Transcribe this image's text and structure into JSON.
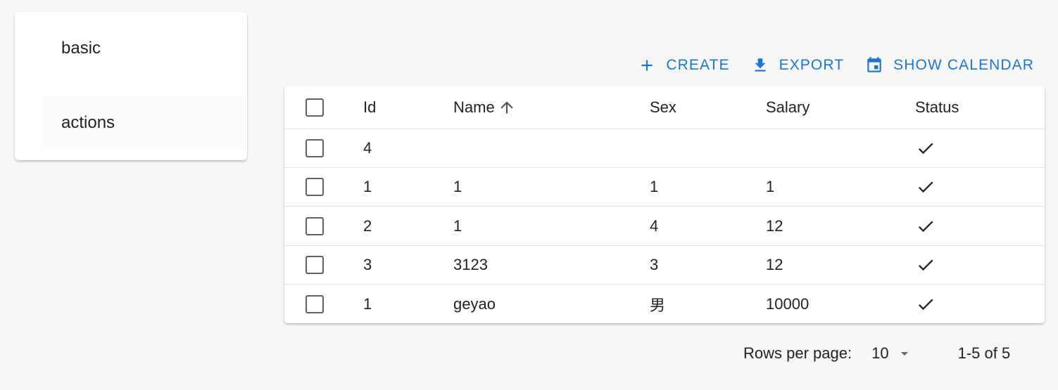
{
  "menu": {
    "items": [
      {
        "label": "basic"
      },
      {
        "label": "actions"
      }
    ]
  },
  "toolbar": {
    "create_label": "CREATE",
    "export_label": "EXPORT",
    "calendar_label": "SHOW CALENDAR",
    "accent_color": "#1976d2",
    "icons": [
      "plus-icon",
      "download-icon",
      "calendar-icon"
    ]
  },
  "table": {
    "columns": [
      "Id",
      "Name",
      "Sex",
      "Salary",
      "Status"
    ],
    "sort": {
      "column": "Name",
      "direction": "ascending",
      "icon": "arrow-up-icon"
    },
    "rows": [
      {
        "id": "4",
        "name": "",
        "sex": "",
        "salary": "",
        "status": "check-icon"
      },
      {
        "id": "1",
        "name": "1",
        "sex": "1",
        "salary": "1",
        "status": "check-icon"
      },
      {
        "id": "2",
        "name": "1",
        "sex": "4",
        "salary": "12",
        "status": "check-icon"
      },
      {
        "id": "3",
        "name": "3123",
        "sex": "3",
        "salary": "12",
        "status": "check-icon"
      },
      {
        "id": "1",
        "name": "geyao",
        "sex": "男",
        "salary": "10000",
        "status": "check-icon"
      }
    ]
  },
  "pagination": {
    "rows_per_page_label": "Rows per page:",
    "rows_per_page_value": "10",
    "range_label": "1-5 of 5"
  }
}
